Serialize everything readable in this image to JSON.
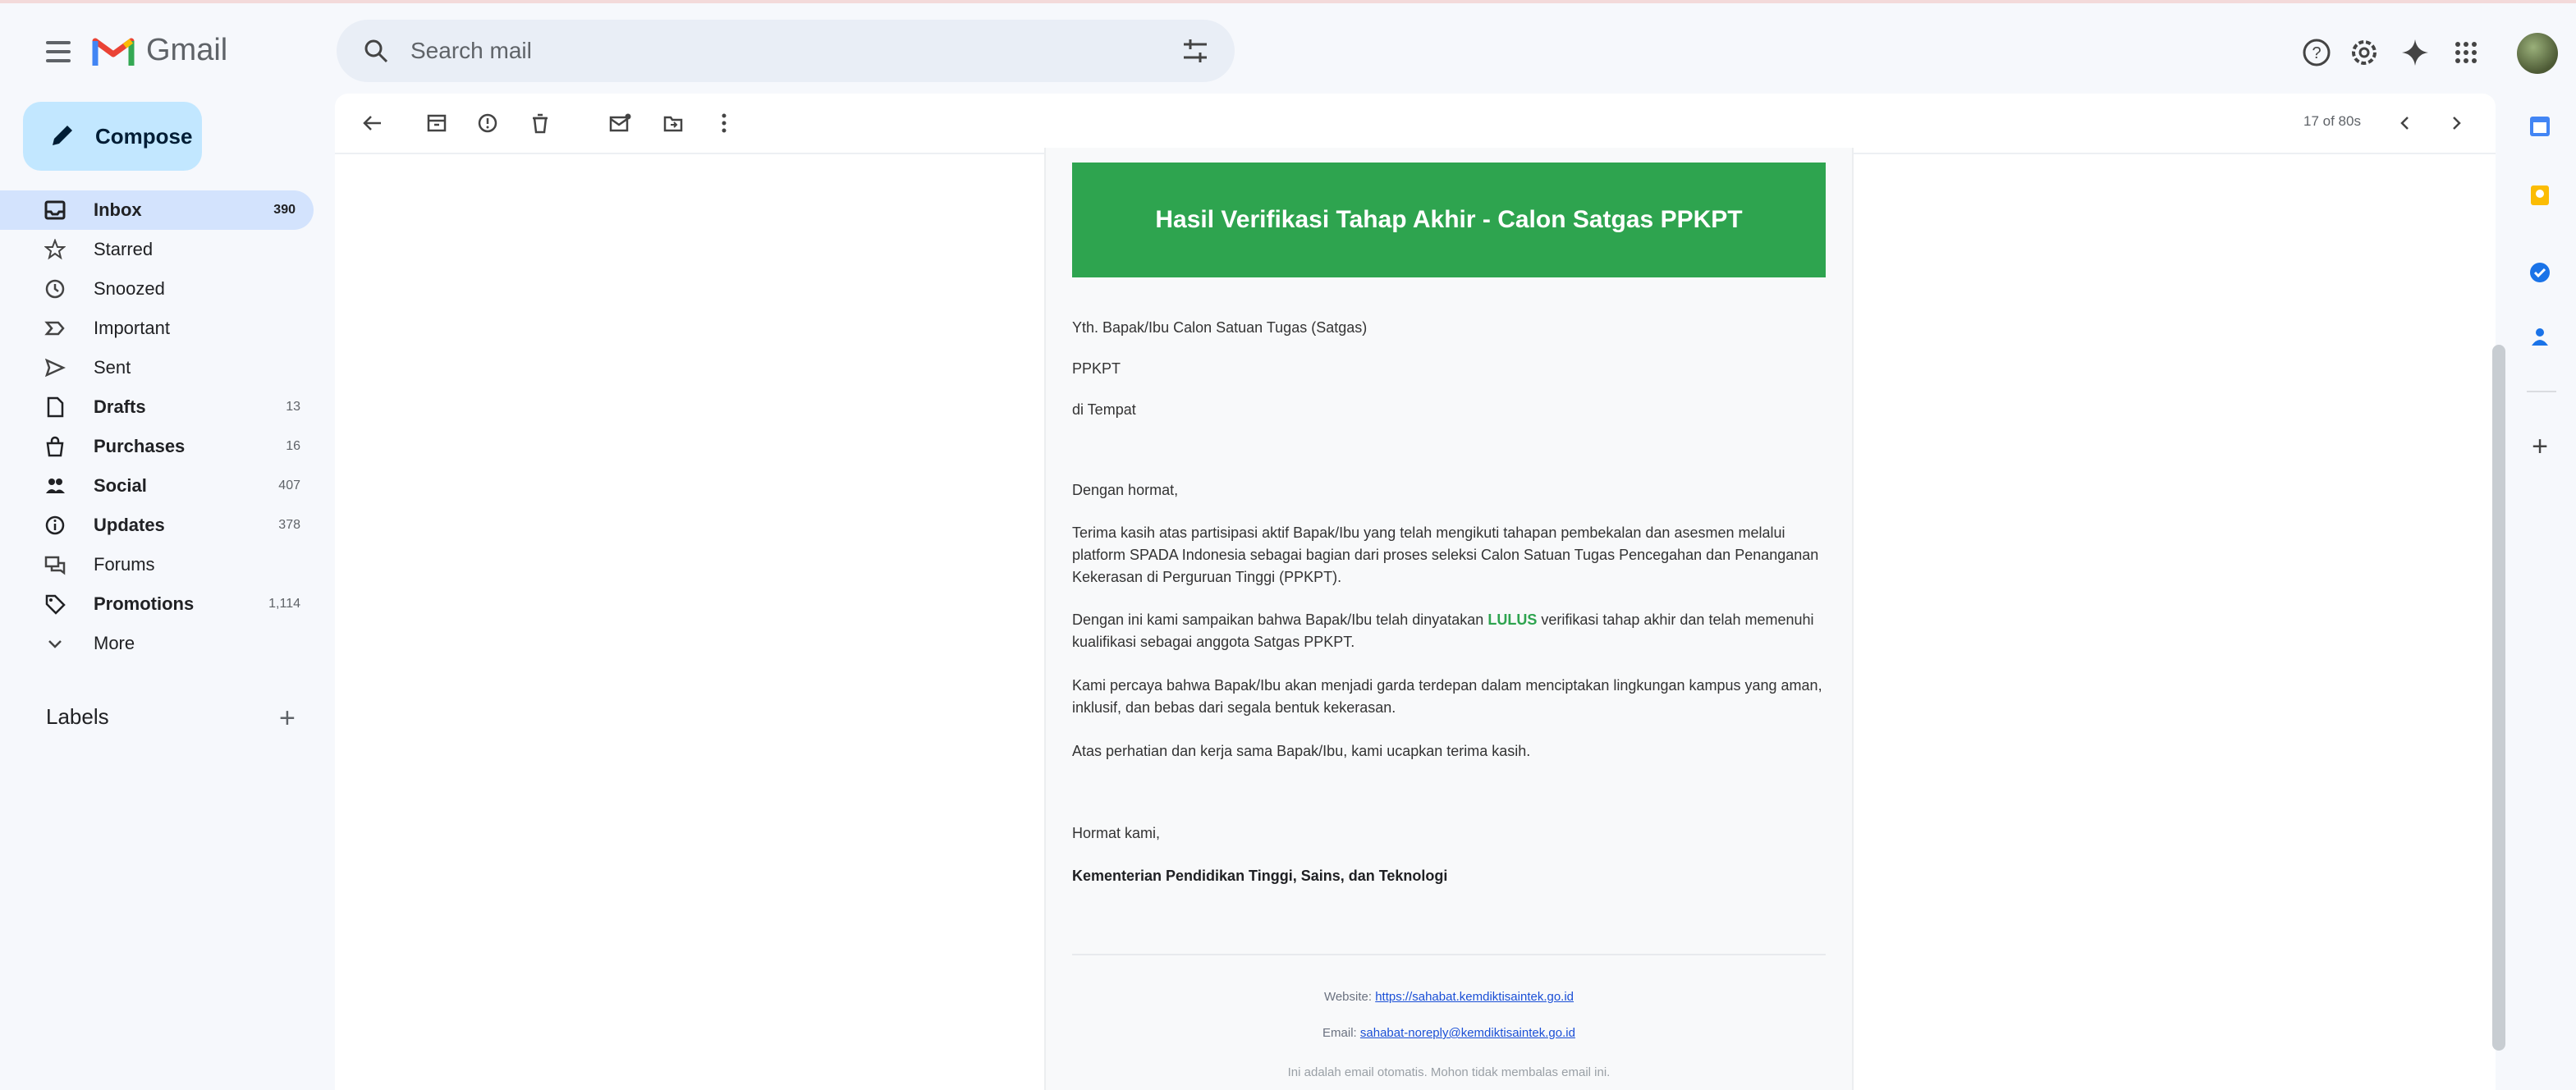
{
  "app": {
    "name": "Gmail"
  },
  "search": {
    "placeholder": "Search mail"
  },
  "compose": {
    "label": "Compose"
  },
  "nav": [
    {
      "label": "Inbox",
      "count": "390",
      "bold": true,
      "icon": "inbox-icon",
      "active": true
    },
    {
      "label": "Starred",
      "count": "",
      "bold": false,
      "icon": "star-icon"
    },
    {
      "label": "Snoozed",
      "count": "",
      "bold": false,
      "icon": "clock-icon"
    },
    {
      "label": "Important",
      "count": "",
      "bold": false,
      "icon": "important-icon"
    },
    {
      "label": "Sent",
      "count": "",
      "bold": false,
      "icon": "send-icon"
    },
    {
      "label": "Drafts",
      "count": "13",
      "bold": true,
      "icon": "draft-icon"
    },
    {
      "label": "Purchases",
      "count": "16",
      "bold": true,
      "icon": "purchases-icon"
    },
    {
      "label": "Social",
      "count": "407",
      "bold": true,
      "icon": "social-icon"
    },
    {
      "label": "Updates",
      "count": "378",
      "bold": true,
      "icon": "info-icon"
    },
    {
      "label": "Forums",
      "count": "",
      "bold": false,
      "icon": "forum-icon"
    },
    {
      "label": "Promotions",
      "count": "1,114",
      "bold": true,
      "icon": "tag-icon"
    },
    {
      "label": "More",
      "count": "",
      "bold": false,
      "icon": "chevron-down-icon"
    }
  ],
  "labels": {
    "title": "Labels"
  },
  "pager": {
    "text": "17 of 80s"
  },
  "email": {
    "banner_title": "Hasil Verifikasi Tahap Akhir - Calon Satgas PPKPT",
    "recipient_line1": "Yth. Bapak/Ibu Calon Satuan Tugas (Satgas)",
    "recipient_line2": "PPKPT",
    "recipient_line3": "di Tempat",
    "greeting": "Dengan hormat,",
    "para1": "Terima kasih atas partisipasi aktif Bapak/Ibu yang telah mengikuti tahapan pembekalan dan asesmen melalui platform SPADA Indonesia sebagai bagian dari proses seleksi Calon Satuan Tugas Pencegahan dan Penanganan Kekerasan di Perguruan Tinggi (PPKPT).",
    "para2_before": "Dengan ini kami sampaikan bahwa Bapak/Ibu telah dinyatakan ",
    "para2_highlight": "LULUS",
    "para2_after": " verifikasi tahap akhir dan telah memenuhi kualifikasi sebagai anggota Satgas PPKPT.",
    "para3": "Kami percaya bahwa Bapak/Ibu akan menjadi garda terdepan dalam menciptakan lingkungan kampus yang aman, inklusif, dan bebas dari segala bentuk kekerasan.",
    "para4": "Atas perhatian dan kerja sama Bapak/Ibu, kami ucapkan terima kasih.",
    "closing": "Hormat kami,",
    "signature": "Kementerian Pendidikan Tinggi, Sains, dan Teknologi",
    "footer_website_label": "Website:",
    "footer_website_link": "https://sahabat.kemdiktisaintek.go.id",
    "footer_email_label": "Email:",
    "footer_email_link": "sahabat-noreply@kemdiktisaintek.go.id",
    "footer_note": "Ini adalah email otomatis. Mohon tidak membalas email ini."
  },
  "colors": {
    "accent_green": "#2ea44f",
    "compose_bg": "#c2e7ff",
    "active_nav": "#d3e3fd"
  }
}
